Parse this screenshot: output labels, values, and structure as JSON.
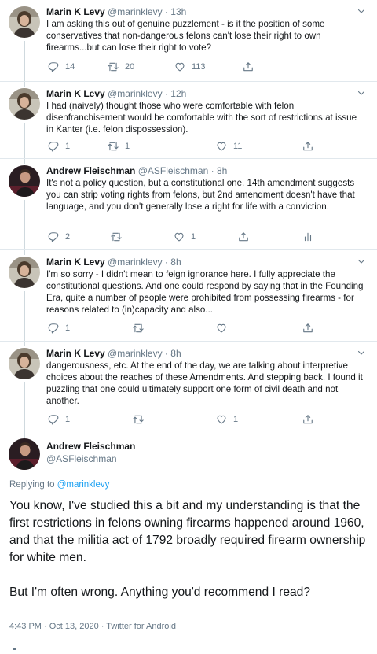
{
  "thread": [
    {
      "name": "Marin K Levy",
      "handle": "@marinklevy",
      "time": "13h",
      "text": "I am asking this out of genuine puzzlement - is it the position of some conservatives that non-dangerous felons can't lose their right to own firearms...but can lose their right to vote?",
      "replies": "14",
      "retweets": "20",
      "likes": "113",
      "avatar": "marin"
    },
    {
      "name": "Marin K Levy",
      "handle": "@marinklevy",
      "time": "12h",
      "text": "I had (naively) thought those who were comfortable with felon disenfranchisement would be comfortable with the sort of restrictions at issue in Kanter (i.e. felon dispossession).",
      "replies": "1",
      "retweets": "1",
      "likes": "11",
      "avatar": "marin"
    },
    {
      "name": "Andrew Fleischman",
      "handle": "@ASFleischman",
      "time": "8h",
      "text": "It's not a policy question, but a constitutional one. 14th amendment suggests you can strip voting rights from felons, but 2nd amendment doesn't have that language, and you don't generally lose a right for life with a conviction.",
      "replies": "2",
      "retweets": "",
      "likes": "1",
      "avatar": "andrew"
    },
    {
      "name": "Marin K Levy",
      "handle": "@marinklevy",
      "time": "8h",
      "text": "I'm so sorry - I didn't mean to feign ignorance here.  I fully appreciate the constitutional questions.  And one could respond by saying that in the Founding Era, quite a number of people were prohibited from possessing firearms - for reasons related to (in)capacity and also...",
      "replies": "1",
      "retweets": "",
      "likes": "",
      "avatar": "marin"
    },
    {
      "name": "Marin K Levy",
      "handle": "@marinklevy",
      "time": "8h",
      "text": "dangerousness, etc.  At the end of the day, we are talking about interpretive choices about the reaches of these Amendments.  And stepping back, I found it puzzling that one could ultimately support one form of civil death and not another.",
      "replies": "1",
      "retweets": "",
      "likes": "1",
      "avatar": "marin"
    }
  ],
  "main": {
    "name": "Andrew Fleischman",
    "handle": "@ASFleischman",
    "replying_prefix": "Replying to ",
    "replying_handle": "@marinklevy",
    "paragraph1": "You know, I've studied this a bit and my understanding is that the first restrictions in felons owning firearms happened around 1960, and that the militia act of 1792 broadly required firearm ownership for white men.",
    "paragraph2": "But I'm often wrong. Anything you'd recommend I read?",
    "meta": "4:43 PM · Oct 13, 2020 · Twitter for Android"
  },
  "dot": "·",
  "colors": {
    "link": "#1da1f2",
    "secondary": "#657786",
    "text": "#14171a",
    "divider": "#e1e8ed"
  },
  "icons": [
    "reply-icon",
    "retweet-icon",
    "like-icon",
    "share-icon",
    "analytics-icon",
    "chevron-down-icon"
  ]
}
